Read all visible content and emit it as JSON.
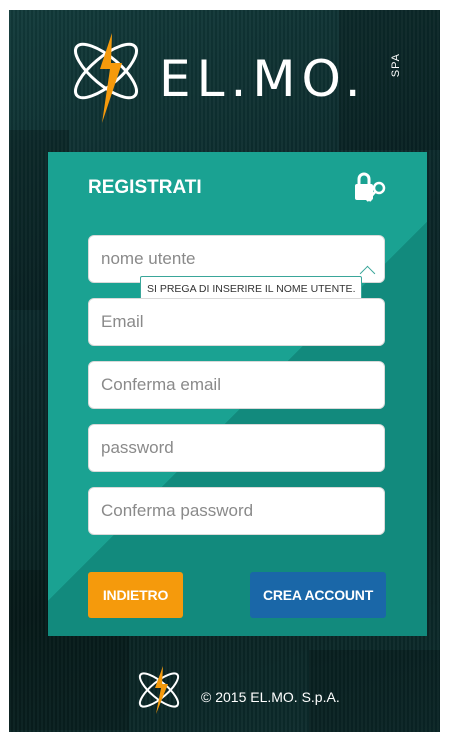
{
  "brand": {
    "logo_text": "EL.MO.",
    "logo_suffix": "SPA",
    "accent_orange": "#f59a0c",
    "teal": "#1aa292",
    "blue": "#1a67a8"
  },
  "form": {
    "title": "REGISTRATI",
    "icon": "lock-key-icon",
    "fields": {
      "username_placeholder": "nome utente",
      "email_placeholder": "Email",
      "confirm_email_placeholder": "Conferma email",
      "password_placeholder": "password",
      "confirm_password_placeholder": "Conferma password"
    },
    "validation_tooltip": "SI PREGA DI INSERIRE IL NOME UTENTE.",
    "back_label": "INDIETRO",
    "create_label": "CREA ACCOUNT"
  },
  "footer": {
    "copyright": "© 2015 EL.MO. S.p.A."
  }
}
